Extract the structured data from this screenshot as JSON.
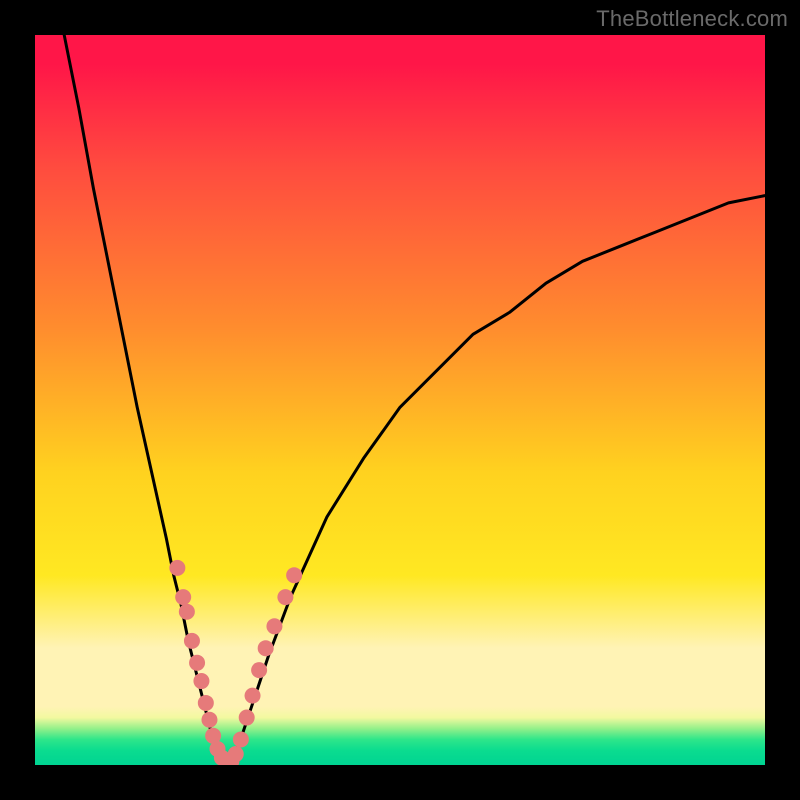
{
  "watermark": "TheBottleneck.com",
  "colors": {
    "gradient_top": "#ff1648",
    "gradient_mid1": "#ff8c2e",
    "gradient_mid2": "#ffe822",
    "gradient_band": "#fff3b5",
    "gradient_bottom": "#00d492",
    "curve": "#000000",
    "dot_fill": "#e67a7a",
    "dot_stroke": "#b85454",
    "frame": "#000000"
  },
  "chart_data": {
    "type": "line",
    "title": "",
    "xlabel": "",
    "ylabel": "",
    "xlim": [
      0,
      100
    ],
    "ylim": [
      0,
      100
    ],
    "grid": false,
    "legend": false,
    "annotations": [
      "TheBottleneck.com"
    ],
    "note": "V-shaped bottleneck curve on color gradient background. x is relative horizontal position (percent of plot width), y is relative vertical position where 0 is bottom (green) and 100 is top (red). Values are estimated from pixel positions since no axes/ticks are shown.",
    "series": [
      {
        "name": "left-branch",
        "x": [
          4,
          6,
          8,
          10,
          12,
          14,
          16,
          18,
          19,
          20,
          21,
          22,
          23,
          24,
          25,
          26
        ],
        "y": [
          100,
          90,
          79,
          69,
          59,
          49,
          40,
          31,
          26,
          22,
          17,
          13,
          9,
          5,
          2,
          0
        ]
      },
      {
        "name": "right-branch",
        "x": [
          26,
          27,
          28,
          29,
          30,
          32,
          35,
          40,
          45,
          50,
          55,
          60,
          65,
          70,
          75,
          80,
          85,
          90,
          95,
          100
        ],
        "y": [
          0,
          1,
          3,
          6,
          9,
          15,
          23,
          34,
          42,
          49,
          54,
          59,
          62,
          66,
          69,
          71,
          73,
          75,
          77,
          78
        ]
      }
    ],
    "scatter_overlay": {
      "name": "sample-dots",
      "note": "salmon-colored sample dots clustered along the lower portion of both branches near the vertex",
      "points": [
        {
          "x": 19.5,
          "y": 27
        },
        {
          "x": 20.3,
          "y": 23
        },
        {
          "x": 20.8,
          "y": 21
        },
        {
          "x": 21.5,
          "y": 17
        },
        {
          "x": 22.2,
          "y": 14
        },
        {
          "x": 22.8,
          "y": 11.5
        },
        {
          "x": 23.4,
          "y": 8.5
        },
        {
          "x": 23.9,
          "y": 6.2
        },
        {
          "x": 24.4,
          "y": 4.0
        },
        {
          "x": 25.0,
          "y": 2.2
        },
        {
          "x": 25.6,
          "y": 1.0
        },
        {
          "x": 26.2,
          "y": 0.5
        },
        {
          "x": 26.9,
          "y": 0.5
        },
        {
          "x": 27.5,
          "y": 1.5
        },
        {
          "x": 28.2,
          "y": 3.5
        },
        {
          "x": 29.0,
          "y": 6.5
        },
        {
          "x": 29.8,
          "y": 9.5
        },
        {
          "x": 30.7,
          "y": 13
        },
        {
          "x": 31.6,
          "y": 16
        },
        {
          "x": 32.8,
          "y": 19
        },
        {
          "x": 34.3,
          "y": 23
        },
        {
          "x": 35.5,
          "y": 26
        }
      ]
    }
  }
}
